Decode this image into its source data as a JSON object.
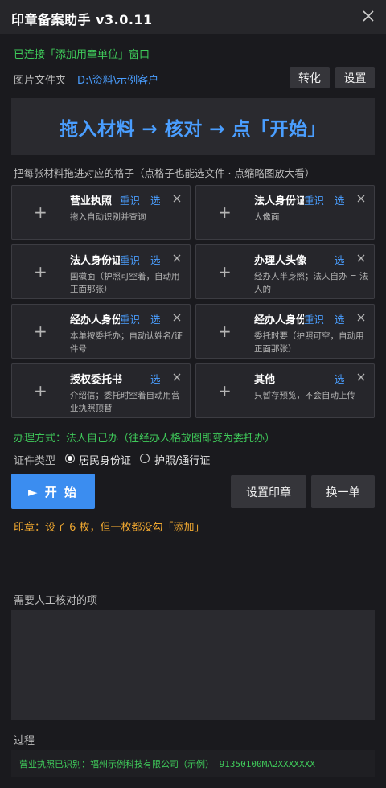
{
  "title": "印章备案助手 v3.0.11",
  "status": "已连接「添加用章单位」窗口",
  "folder": {
    "label": "图片文件夹",
    "path": "D:\\资料\\示例客户"
  },
  "buttons": {
    "convert": "转化",
    "settings": "设置",
    "start": "► 开 始",
    "set_seal": "设置印章",
    "switch": "换一单"
  },
  "banner": "拖入材料 → 核对 → 点「开始」",
  "hint": "把每张材料拖进对应的格子（点格子也能选文件 · 点缩略图放大看）",
  "slots": [
    {
      "name": "营业执照",
      "reid": "重识",
      "pick": "选",
      "desc": "拖入自动识别并查询"
    },
    {
      "name": "法人身份证",
      "reid": "重识",
      "pick": "选",
      "desc": "人像面"
    },
    {
      "name": "法人身份证",
      "reid": "重识",
      "pick": "选",
      "desc": "国徽面（护照可空着，自动用正面那张）"
    },
    {
      "name": "办理人头像",
      "reid": "",
      "pick": "选",
      "desc": "经办人半身照；法人自办 = 法人的"
    },
    {
      "name": "经办人身份证",
      "reid": "重识",
      "pick": "选",
      "desc": "本单按委托办；自动认姓名/证件号"
    },
    {
      "name": "经办人身份证",
      "reid": "重识",
      "pick": "选",
      "desc": "委托时要（护照可空，自动用正面那张）"
    },
    {
      "name": "授权委托书",
      "reid": "",
      "pick": "选",
      "desc": "介绍信；委托时空着自动用营业执照顶替"
    },
    {
      "name": "其他",
      "reid": "",
      "pick": "选",
      "desc": "只暂存预览，不会自动上传"
    }
  ],
  "mode": "办理方式：法人自己办（往经办人格放图即变为委托办）",
  "cert": {
    "label": "证件类型",
    "option1": "居民身份证",
    "option2": "护照/通行证",
    "selected": "居民身份证"
  },
  "seal_status": "印章：设了 6 枚，但一枚都没勾「添加」",
  "review_label": "需要人工核对的项",
  "process_label": "过程",
  "process_text": "营业执照已识别：福州示例科技有限公司（示例） 91350100MA2XXXXXXX",
  "colors": {
    "accent": "#4a9eff",
    "success": "#3fc95a",
    "warning": "#f0a830",
    "primary_button": "#3b8df0"
  },
  "icons": {
    "close": "close-icon",
    "plus": "plus-icon",
    "remove": "remove-icon"
  }
}
